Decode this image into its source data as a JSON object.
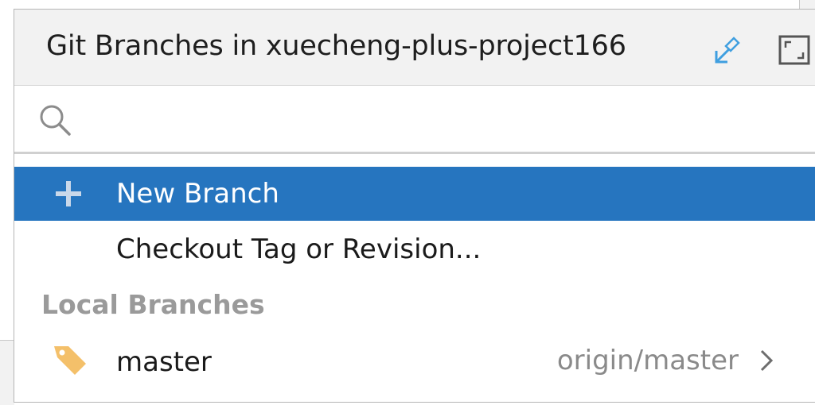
{
  "popup": {
    "title": "Git Branches in xuecheng-plus-project166",
    "header_icons": [
      "pin-icon",
      "expand-icon"
    ]
  },
  "search": {
    "value": "",
    "placeholder": "",
    "icon": "search-icon"
  },
  "actions": [
    {
      "label": "New Branch",
      "icon": "plus-icon",
      "selected": true
    },
    {
      "label": "Checkout Tag or Revision...",
      "icon": null,
      "selected": false
    }
  ],
  "local_branches": {
    "header": "Local Branches",
    "items": [
      {
        "name": "master",
        "tracking": "origin/master",
        "icon": "tag-icon"
      }
    ]
  },
  "colors": {
    "selection": "#2675bf",
    "header_bg": "#f2f2f2",
    "section_header": "#9a9a9a",
    "tag_icon": "#f4c06a",
    "pin_icon": "#3f9fe0"
  }
}
